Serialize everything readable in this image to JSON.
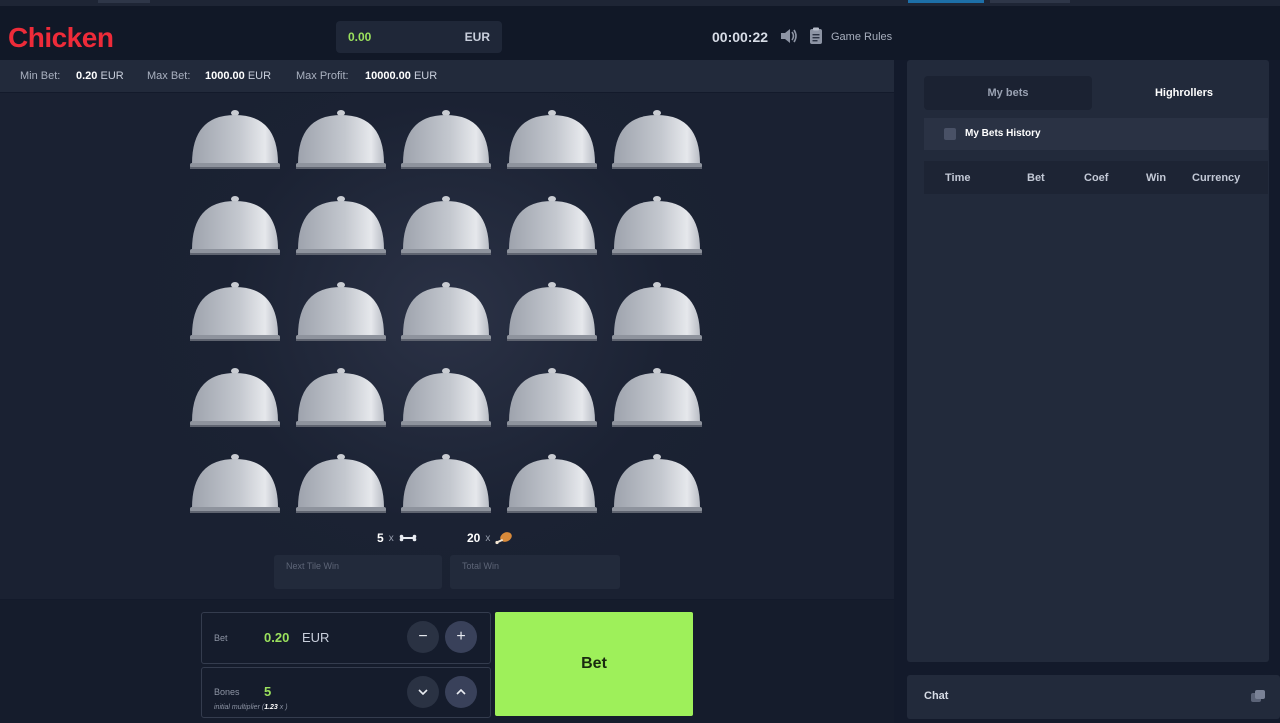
{
  "header": {
    "logo": "Chicken",
    "balance": {
      "value": "0.00",
      "currency": "EUR"
    },
    "timer": "00:00:22",
    "rules_label": "Game Rules"
  },
  "limits": {
    "min_label": "Min Bet:",
    "min_value": "0.20",
    "min_currency": "EUR",
    "max_label": "Max Bet:",
    "max_value": "1000.00",
    "max_currency": "EUR",
    "profit_label": "Max Profit:",
    "profit_value": "10000.00",
    "profit_currency": "EUR"
  },
  "board": {
    "rows": 5,
    "cols": 5,
    "bones_count": "5",
    "chicken_count": "20",
    "multiply_sign": "x",
    "next_tile_win_placeholder": "Next Tile Win",
    "total_win_placeholder": "Total Win"
  },
  "controls": {
    "bet_label": "Bet",
    "bet_value": "0.20",
    "bet_currency": "EUR",
    "minus": "−",
    "plus": "+",
    "bones_label": "Bones",
    "bones_value": "5",
    "multiplier_label": "initial multiplier (",
    "multiplier_value": "1.23",
    "multiplier_suffix": " x )",
    "bet_button": "Bet"
  },
  "panel": {
    "tabs": [
      {
        "label": "My bets"
      },
      {
        "label": "Highrollers"
      }
    ],
    "history_title": "My Bets History",
    "columns": [
      "Time",
      "Bet",
      "Coef",
      "Win",
      "Currency"
    ]
  },
  "chat": {
    "label": "Chat"
  },
  "colors": {
    "brand": "#ee2b39",
    "accent_green": "#9be15d",
    "bet_button": "#9ef05a"
  },
  "icons": {
    "sound": "speaker-icon",
    "rules": "clipboard-icon",
    "bone": "bone-icon",
    "chicken": "chicken-leg-icon",
    "history": "list-icon",
    "chat": "chat-bubble-icon"
  }
}
